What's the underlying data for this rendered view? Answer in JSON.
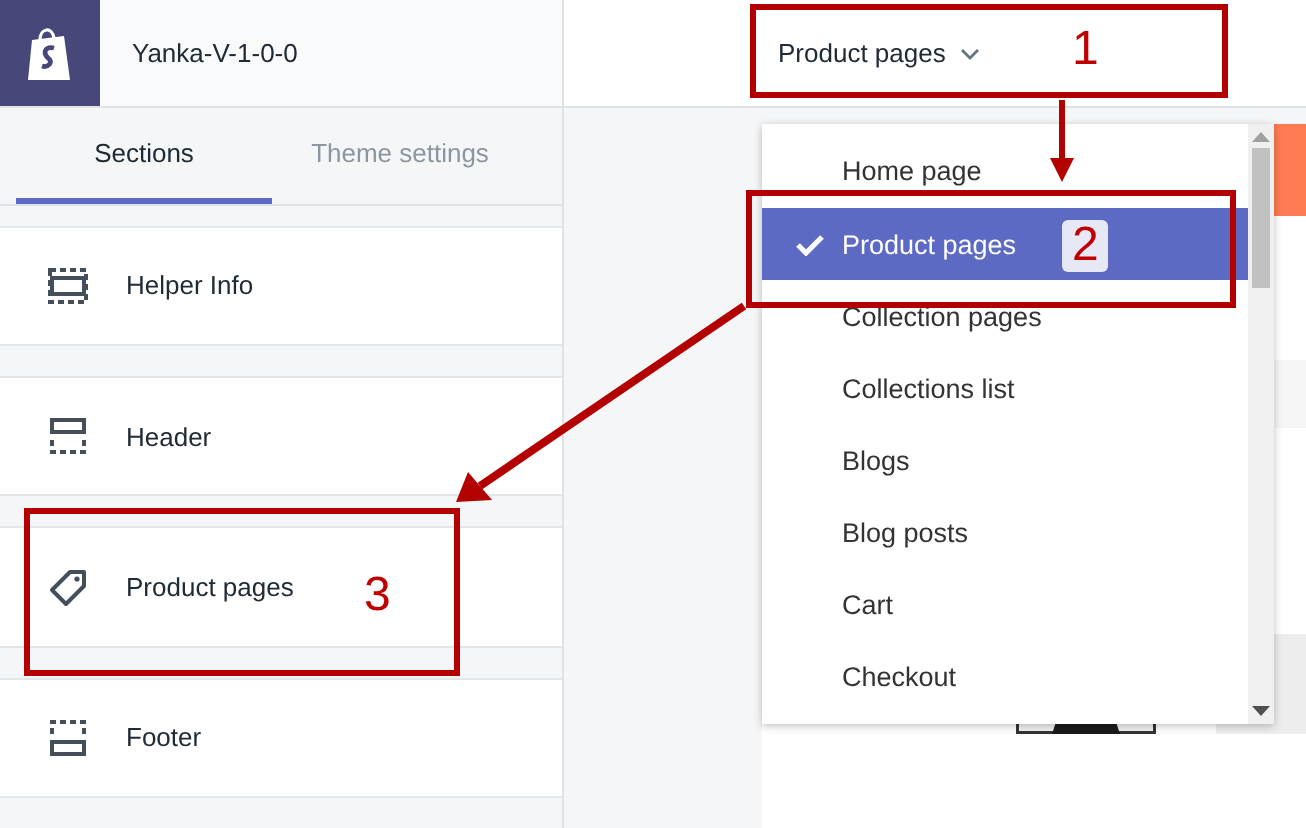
{
  "app": {
    "store_name": "Yanka-V-1-0-0"
  },
  "tabs": [
    {
      "label": "Sections",
      "selected": true
    },
    {
      "label": "Theme settings",
      "selected": false
    }
  ],
  "sections": [
    {
      "label": "Helper Info",
      "kind": "helper"
    },
    {
      "label": "Header",
      "kind": "header"
    },
    {
      "label": "Product pages",
      "kind": "tag"
    },
    {
      "label": "Footer",
      "kind": "footer"
    }
  ],
  "page_selector": {
    "value": "Product pages"
  },
  "page_menu": [
    {
      "label": "Home page",
      "selected": false
    },
    {
      "label": "Product pages",
      "selected": true
    },
    {
      "label": "Collection pages",
      "selected": false
    },
    {
      "label": "Collections list",
      "selected": false
    },
    {
      "label": "Blogs",
      "selected": false
    },
    {
      "label": "Blog posts",
      "selected": false
    },
    {
      "label": "Cart",
      "selected": false
    },
    {
      "label": "Checkout",
      "selected": false
    }
  ],
  "annotations": [
    {
      "number": "1"
    },
    {
      "number": "2"
    },
    {
      "number": "3"
    }
  ]
}
